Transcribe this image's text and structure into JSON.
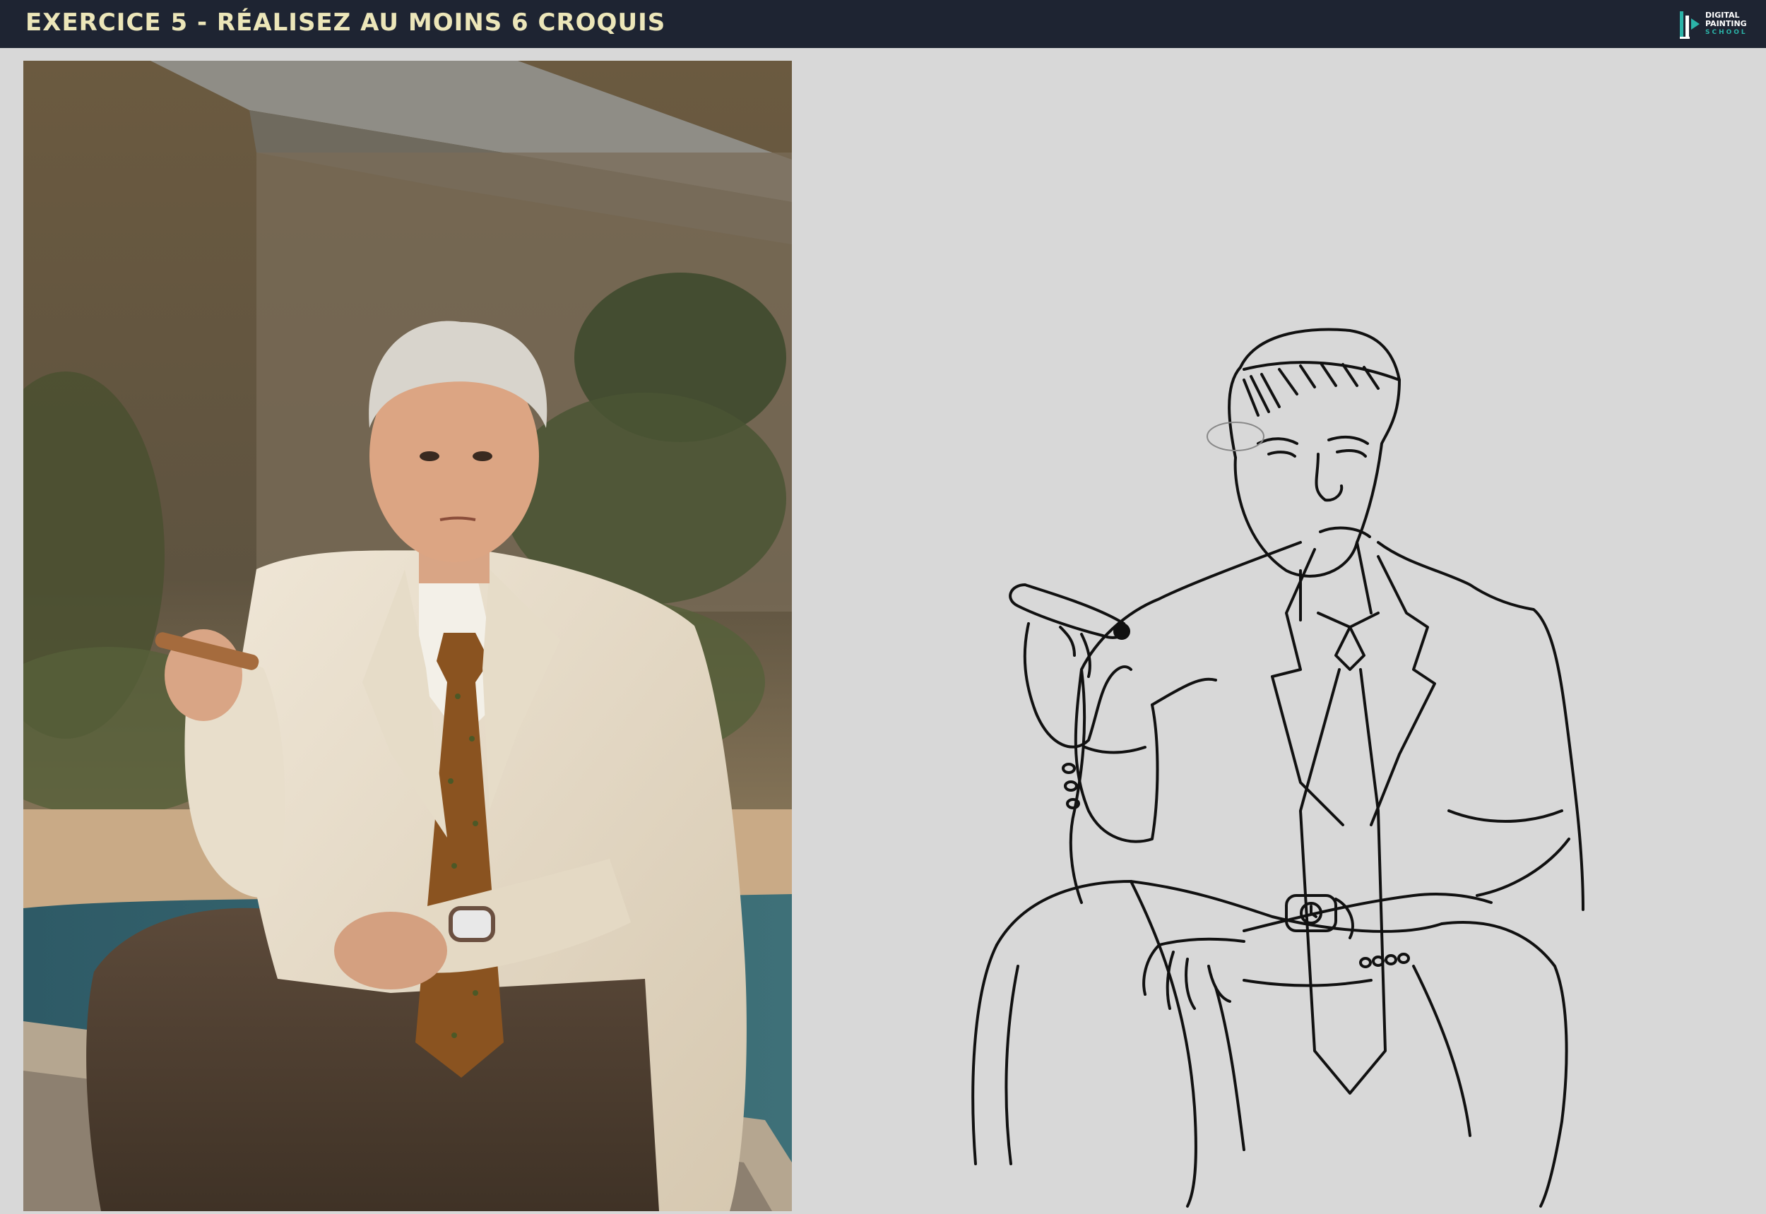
{
  "header": {
    "title": "EXERCICE 5 - RÉALISEZ AU MOINS 6 CROQUIS",
    "logo": {
      "line1": "DIGITAL",
      "line2": "PAINTING",
      "line3": "SCHOOL",
      "icon": "brush-logo-icon"
    }
  },
  "colors": {
    "header_bg": "#1e2432",
    "title_color": "#ece6b9",
    "canvas_bg": "#d8d8d8",
    "accent": "#2bb3a8"
  },
  "panels": {
    "reference_photo": "photo-reference",
    "sketch": "line-drawing-sketch"
  }
}
